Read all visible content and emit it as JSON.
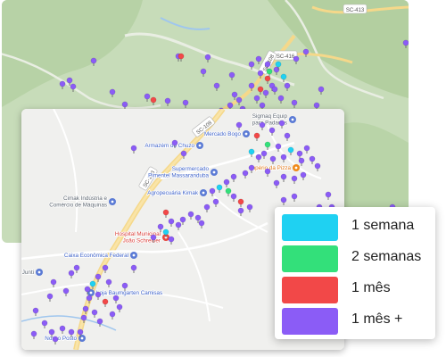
{
  "back_map": {
    "road_shields": [
      "SC-413",
      "SC-416",
      "SC-108"
    ]
  },
  "front_map": {
    "road_shields": [
      "SC-108"
    ],
    "places": [
      {
        "name": "Sigmaq Equipamentos para Padarias",
        "line1": "Sigmaq Equip",
        "line2": "para Padarias",
        "kind": "business"
      },
      {
        "name": "Mercado Bogo",
        "kind": "shop"
      },
      {
        "name": "Armazém do Chuzo",
        "kind": "shop"
      },
      {
        "name": "Império da Pizza",
        "kind": "food"
      },
      {
        "name": "Supermercado Pimentel Massaranduba",
        "line1": "Supermercado",
        "line2": "Pimentel Massaranduba",
        "kind": "shop"
      },
      {
        "name": "Agropecuária Kimak",
        "kind": "shop"
      },
      {
        "name": "Cimak Indústria e Comércio de Máquinas",
        "line1": "Cimak Indústria e",
        "line2": "Comércio de Máquinas",
        "kind": "business"
      },
      {
        "name": "Hospital Municipal João Schreiber",
        "line1": "Hospital Municipal",
        "line2": "João Schreiber",
        "kind": "hospital"
      },
      {
        "name": "Caixa Econômica Federal",
        "kind": "bank"
      },
      {
        "name": "Loja Baumgarten Camisas",
        "kind": "shop"
      },
      {
        "name": "Mercado",
        "kind": "shop"
      },
      {
        "name": "Nosso Posto",
        "kind": "fuel"
      },
      {
        "name": "Junti",
        "kind": "business"
      }
    ]
  },
  "legend": {
    "items": [
      {
        "label": "1 semana",
        "color": "#1fd1f2"
      },
      {
        "label": "2 semanas",
        "color": "#33e07a"
      },
      {
        "label": "1 mês",
        "color": "#f24848"
      },
      {
        "label": "1 mês +",
        "color": "#8b5cf6"
      }
    ]
  },
  "colors": {
    "back_map_base": "#c7dcb9",
    "front_map_base": "#f0f0ee",
    "main_road": "#f5d88a",
    "water": "#9fc6ee",
    "business_pin": "#5b7bd5",
    "food_pin": "#f08a1c",
    "hospital_pin": "#e8453c"
  }
}
